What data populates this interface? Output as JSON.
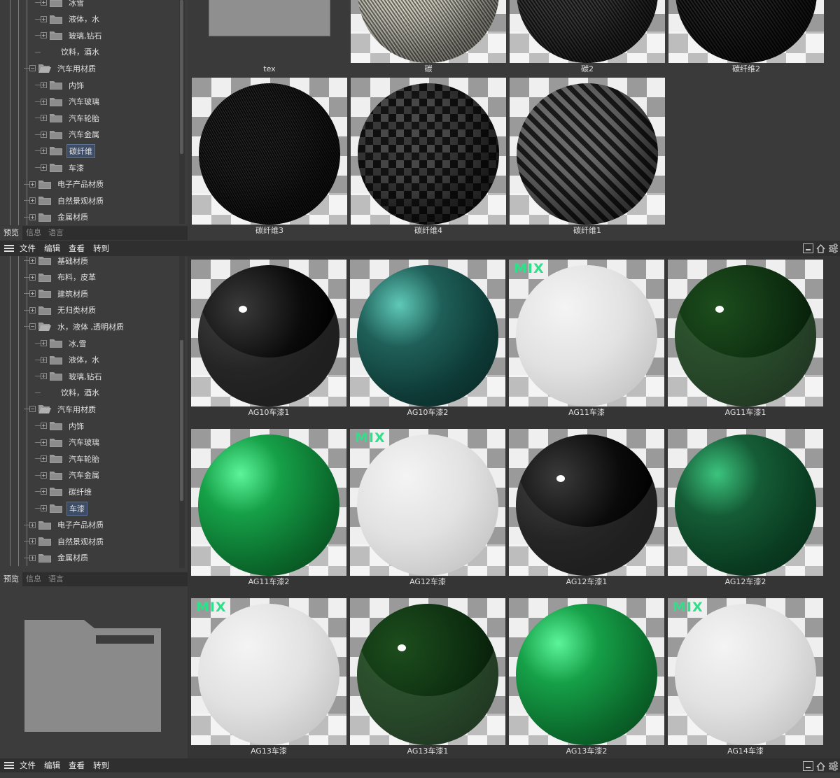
{
  "top_panel": {
    "tree": [
      {
        "label": "冰雪",
        "level": 2,
        "kind": "folder"
      },
      {
        "label": "液体，水",
        "level": 2,
        "kind": "folder"
      },
      {
        "label": "玻璃,钻石",
        "level": 2,
        "kind": "folder"
      },
      {
        "label": "饮料，酒水",
        "level": 2,
        "kind": "leaf"
      },
      {
        "label": "汽车用材质",
        "level": 1,
        "kind": "open"
      },
      {
        "label": "内饰",
        "level": 2,
        "kind": "folder"
      },
      {
        "label": "汽车玻璃",
        "level": 2,
        "kind": "folder"
      },
      {
        "label": "汽车轮胎",
        "level": 2,
        "kind": "folder"
      },
      {
        "label": "汽车金属",
        "level": 2,
        "kind": "folder"
      },
      {
        "label": "碳纤维",
        "level": 2,
        "kind": "folder",
        "selected": true
      },
      {
        "label": "车漆",
        "level": 2,
        "kind": "folder"
      },
      {
        "label": "电子产品材质",
        "level": 1,
        "kind": "folder"
      },
      {
        "label": "自然景观材质",
        "level": 1,
        "kind": "folder"
      },
      {
        "label": "金属材质",
        "level": 1,
        "kind": "folder"
      }
    ],
    "tabs": [
      "预览",
      "信息",
      "语言"
    ],
    "active_tab": "预览",
    "grid": [
      {
        "label": "tex",
        "type": "tex"
      },
      {
        "label": "碳",
        "type": "carbon-light"
      },
      {
        "label": "碳2",
        "type": "carbon-dark"
      },
      {
        "label": "碳纤维2",
        "type": "carbon-black"
      },
      {
        "label": "碳纤维3",
        "type": "carbon-fine"
      },
      {
        "label": "碳纤维4",
        "type": "carbon-weave"
      },
      {
        "label": "碳纤维1",
        "type": "carbon-check"
      }
    ]
  },
  "menubar": {
    "items": [
      "文件",
      "编辑",
      "查看",
      "转到"
    ]
  },
  "bottom_panel": {
    "tree": [
      {
        "label": "基础材质",
        "level": 1,
        "kind": "folder"
      },
      {
        "label": "布料，皮革",
        "level": 1,
        "kind": "folder"
      },
      {
        "label": "建筑材质",
        "level": 1,
        "kind": "folder"
      },
      {
        "label": "无归类材质",
        "level": 1,
        "kind": "folder"
      },
      {
        "label": "水，液体 ,透明材质",
        "level": 1,
        "kind": "open"
      },
      {
        "label": "冰,雪",
        "level": 2,
        "kind": "folder"
      },
      {
        "label": "液体，水",
        "level": 2,
        "kind": "folder"
      },
      {
        "label": "玻璃,钻石",
        "level": 2,
        "kind": "folder"
      },
      {
        "label": "饮料，酒水",
        "level": 2,
        "kind": "leaf"
      },
      {
        "label": "汽车用材质",
        "level": 1,
        "kind": "open"
      },
      {
        "label": "内饰",
        "level": 2,
        "kind": "folder"
      },
      {
        "label": "汽车玻璃",
        "level": 2,
        "kind": "folder"
      },
      {
        "label": "汽车轮胎",
        "level": 2,
        "kind": "folder"
      },
      {
        "label": "汽车金属",
        "level": 2,
        "kind": "folder"
      },
      {
        "label": "碳纤维",
        "level": 2,
        "kind": "folder"
      },
      {
        "label": "车漆",
        "level": 2,
        "kind": "folder",
        "selected": true
      },
      {
        "label": "电子产品材质",
        "level": 1,
        "kind": "folder"
      },
      {
        "label": "自然景观材质",
        "level": 1,
        "kind": "folder"
      },
      {
        "label": "金属材质",
        "level": 1,
        "kind": "folder"
      }
    ],
    "tabs": [
      "预览",
      "信息",
      "语言"
    ],
    "active_tab": "预览",
    "grid": [
      {
        "label": "AG10车漆1",
        "type": "glossy-black",
        "mix": false
      },
      {
        "label": "AG10车漆2",
        "type": "teal",
        "mix": false
      },
      {
        "label": "AG11车漆",
        "type": "white",
        "mix": true
      },
      {
        "label": "AG11车漆1",
        "type": "glossy-green",
        "mix": false
      },
      {
        "label": "AG11车漆2",
        "type": "green",
        "mix": false
      },
      {
        "label": "AG12车漆",
        "type": "white",
        "mix": true
      },
      {
        "label": "AG12车漆1",
        "type": "glossy-black",
        "mix": false
      },
      {
        "label": "AG12车漆2",
        "type": "dark-green",
        "mix": false
      },
      {
        "label": "AG13车漆",
        "type": "white",
        "mix": true
      },
      {
        "label": "AG13车漆1",
        "type": "glossy-green",
        "mix": false
      },
      {
        "label": "AG13车漆2",
        "type": "green",
        "mix": false
      },
      {
        "label": "AG14车漆",
        "type": "white",
        "mix": true
      }
    ]
  },
  "mix_badge": "MIX",
  "colors": {
    "panel_bg": "#3c3c3c",
    "menubar_bg": "#2f2f2f",
    "selection": "#3e4d66",
    "mix_green": "#2fe08a"
  },
  "icons": [
    "hamburger-icon",
    "folder-icon",
    "minimize-icon",
    "restore-icon",
    "settings-icon"
  ]
}
